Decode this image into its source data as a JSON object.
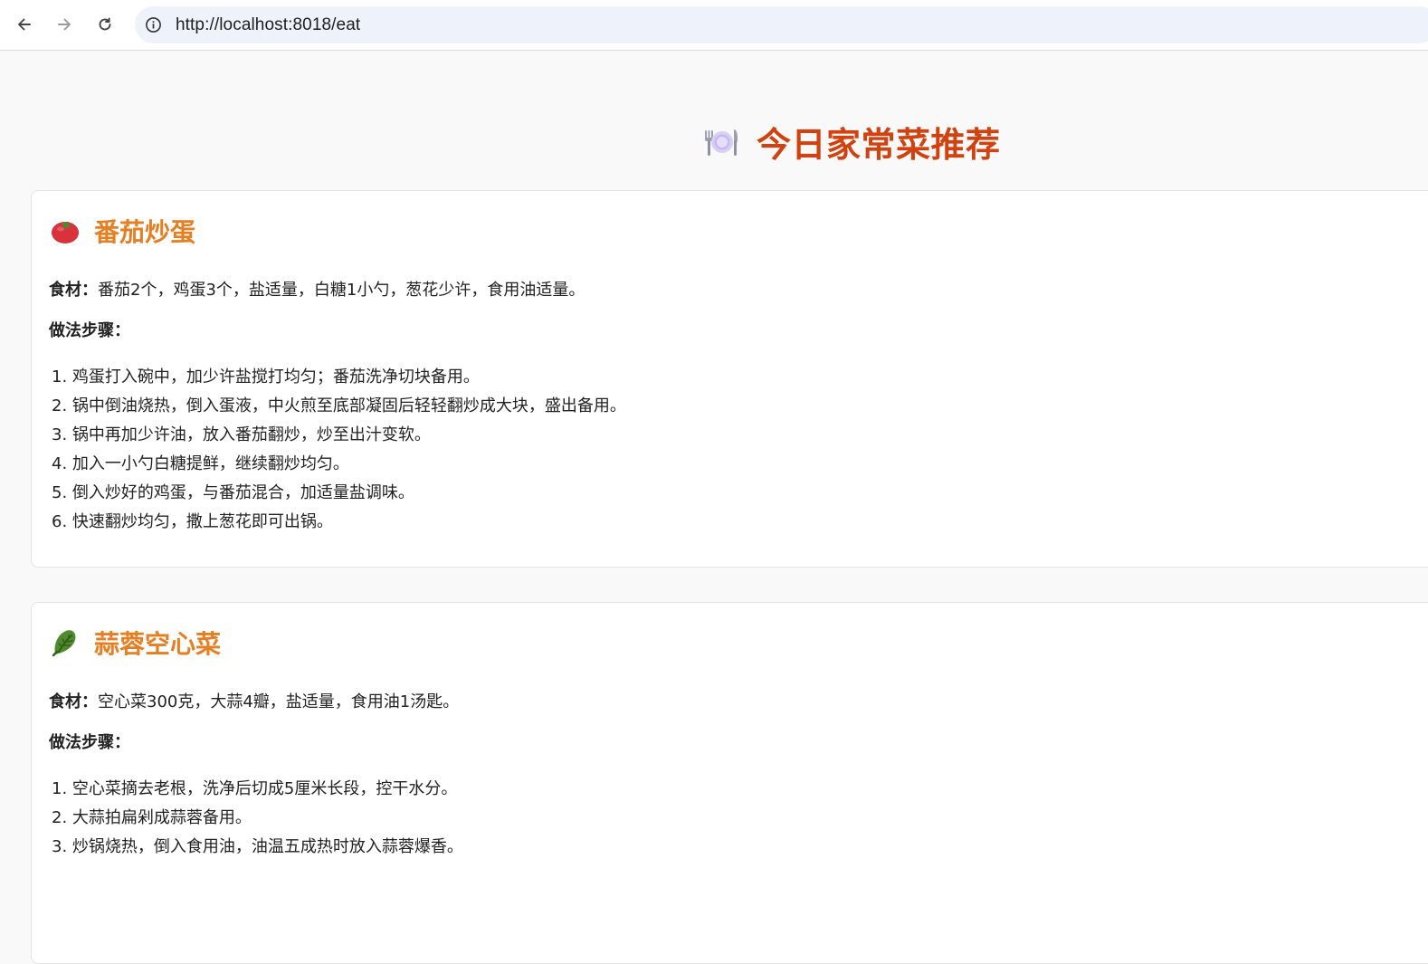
{
  "browser": {
    "url": "http://localhost:8018/eat"
  },
  "page": {
    "title": "今日家常菜推荐",
    "title_icon": "plate-with-cutlery-icon",
    "ingredients_label": "食材：",
    "steps_label": "做法步骤："
  },
  "recipes": [
    {
      "icon": "tomato-icon",
      "name": "番茄炒蛋",
      "ingredients": "番茄2个，鸡蛋3个，盐适量，白糖1小勺，葱花少许，食用油适量。",
      "steps": [
        "1. 鸡蛋打入碗中，加少许盐搅打均匀；番茄洗净切块备用。",
        "2. 锅中倒油烧热，倒入蛋液，中火煎至底部凝固后轻轻翻炒成大块，盛出备用。",
        "3. 锅中再加少许油，放入番茄翻炒，炒至出汁变软。",
        "4. 加入一小勺白糖提鲜，继续翻炒均匀。",
        "5. 倒入炒好的鸡蛋，与番茄混合，加适量盐调味。",
        "6. 快速翻炒均匀，撒上葱花即可出锅。"
      ]
    },
    {
      "icon": "leafy-green-icon",
      "name": "蒜蓉空心菜",
      "ingredients": "空心菜300克，大蒜4瓣，盐适量，食用油1汤匙。",
      "steps": [
        "1. 空心菜摘去老根，洗净后切成5厘米长段，控干水分。",
        "2. 大蒜拍扁剁成蒜蓉备用。",
        "3. 炒锅烧热，倒入食用油，油温五成热时放入蒜蓉爆香。"
      ]
    }
  ],
  "colors": {
    "title": "#d0420f",
    "dish_name": "#e67e22",
    "omnibox": "#eef2fa",
    "page_bg": "#f9f9f9"
  }
}
